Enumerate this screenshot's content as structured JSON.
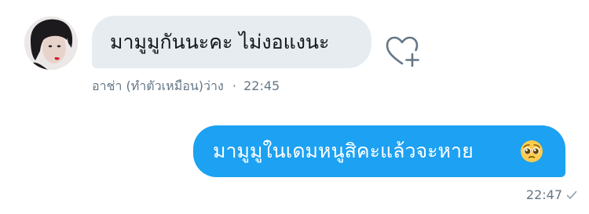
{
  "conversation": {
    "incoming": {
      "text": "มามูมูกันนะคะ ไม่งอแงนะ",
      "sender_name": "อาช่า (ทำตัวเหมือน)ว่าง",
      "separator": "·",
      "time": "22:45",
      "avatar_icon": "user-avatar-photo"
    },
    "outgoing": {
      "text": "มามูมูในเดมหนูสิคะแล้วจะหาย",
      "emoji_icon": "pleading-face-emoji",
      "time": "22:47",
      "status_icon": "sent-check-icon"
    },
    "reaction_icon": "heart-plus-icon"
  },
  "colors": {
    "incoming_bubble": "#e6ecf0",
    "outgoing_bubble": "#1da1f2",
    "meta_text": "#657786",
    "icon_gray": "#657786"
  }
}
